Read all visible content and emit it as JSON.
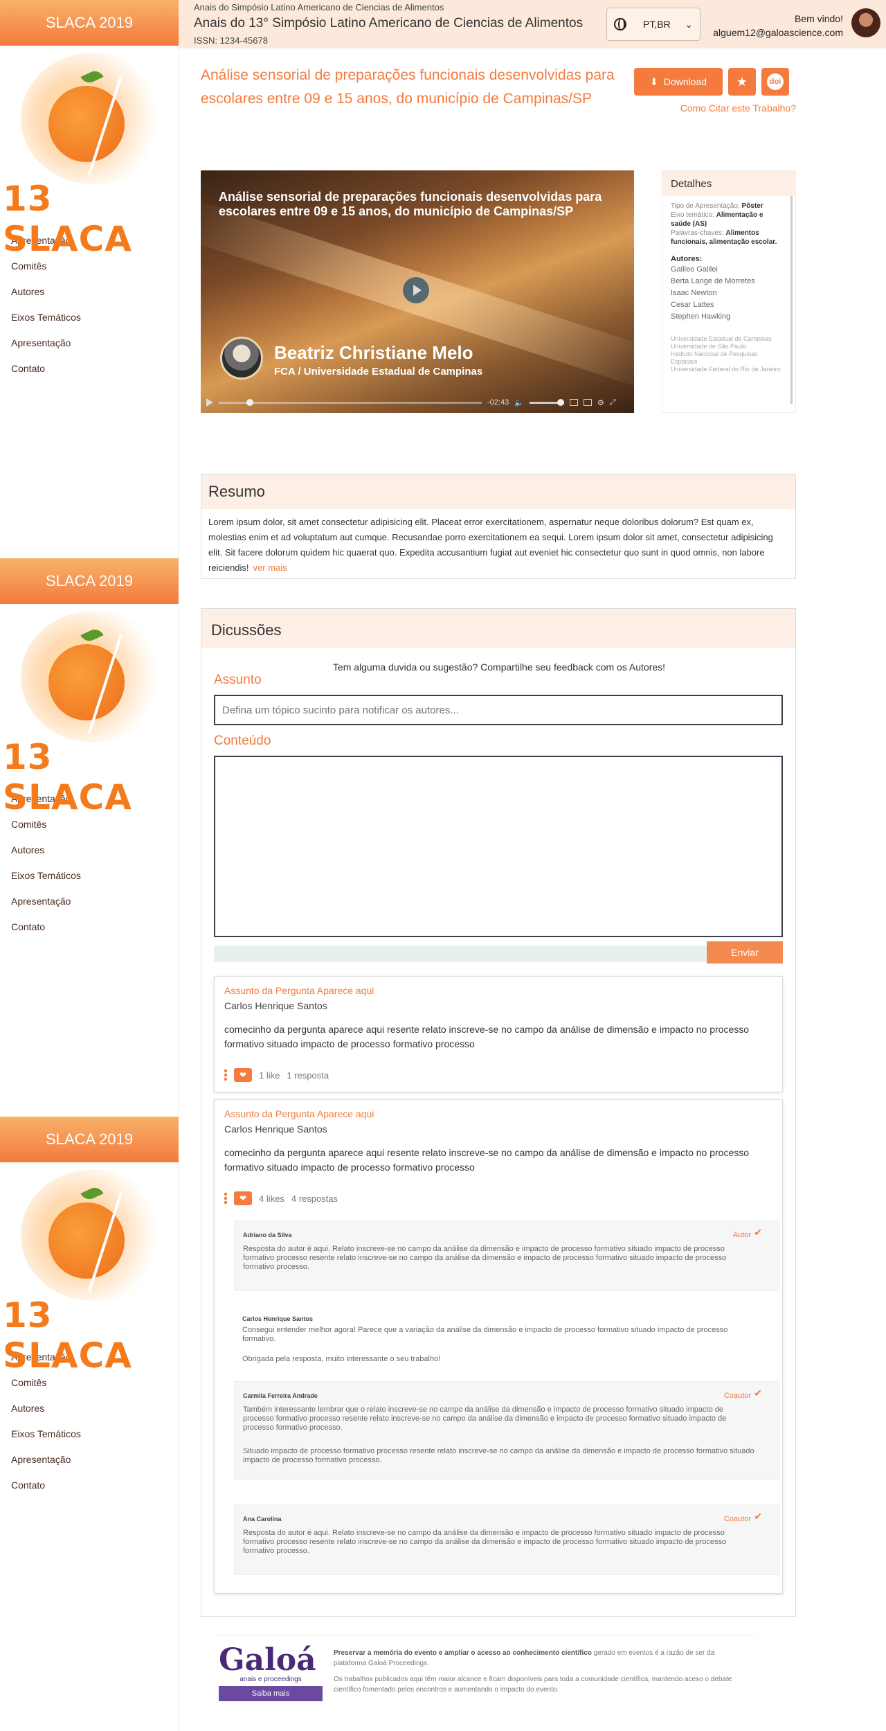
{
  "sidebar": {
    "header": "SLACA 2019",
    "logo_text": "13 SLACA",
    "nav": [
      "Apresentação",
      "Comitês",
      "Autores",
      "Eixos Temáticos",
      "Apresentação",
      "Contato"
    ]
  },
  "topbar": {
    "event_small": "Anais do Simpósio Latino Americano de Ciencias de Alimentos",
    "event_title": "Anais do 13° Simpósio Latino Americano de Ciencias de Alimentos",
    "issn": "ISSN: 1234-45678",
    "language": "PT,BR",
    "welcome": "Bem vindo!",
    "email": "alguem12@galoascience.com"
  },
  "paper": {
    "title": "Análise sensorial de preparações funcionais desenvolvidas para escolares entre 09 e 15 anos, do município de Campinas/SP",
    "download_label": "Download",
    "cite_link": "Como Citar este Trabalho?"
  },
  "video": {
    "title": "Análise sensorial de preparações funcionais desenvolvidas para escolares entre 09 e 15 anos, do município de Campinas/SP",
    "presenter": "Beatriz Christiane Melo",
    "affiliation": "FCA / Universidade Estadual de Campinas",
    "time_remaining": "-02:43"
  },
  "details": {
    "heading": "Detalhes",
    "type_label": "Tipo de Apresentação:",
    "type_value": "Pôster",
    "axis_label": "Eixo temático:",
    "axis_value": "Alimentação e saúde (AS)",
    "keywords_label": "Palavras-chaves:",
    "keywords_value": "Alimentos funcionais, alimentação escolar.",
    "authors_heading": "Autores:",
    "authors": [
      "Galileo Galilei",
      "Berta Lange de Morretes",
      "Isaac Newton",
      "Cesar Lattes",
      "Stephen Hawking"
    ],
    "institutions": [
      "Universidade Estadual de Campinas",
      "Universidade de São Paulo",
      "Instituto Nacional de Pesquisas Espaciais",
      "Universidade Federal do Rio de Janeiro"
    ]
  },
  "resumo": {
    "heading": "Resumo",
    "text": "Lorem ipsum dolor, sit amet consectetur adipisicing elit. Placeat error exercitationem, aspernatur neque doloribus dolorum? Est quam ex, molestias enim et ad voluptatum aut cumque. Recusandae porro exercitationem ea sequi. Lorem ipsum dolor sit amet, consectetur adipisicing elit. Sit facere dolorum quidem hic quaerat quo. Expedita accusantium fugiat aut eveniet hic consectetur quo sunt in quod omnis, non labore reiciendis!",
    "more": "ver mais"
  },
  "discussion": {
    "heading": "Dicussões",
    "prompt": "Tem alguma duvida ou sugestão? Compartilhe seu feedback com os Autores!",
    "subject_label": "Assunto",
    "subject_placeholder": "Defina um tópico sucinto para notificar os autores...",
    "content_label": "Conteúdo",
    "send_label": "Enviar",
    "questions": [
      {
        "subject": "Assunto da Pergunta Aparece aqui",
        "author": "Carlos Henrique Santos",
        "text": "comecinho da pergunta aparece aqui resente relato inscreve-se no campo da análise de dimensão e impacto no processo formativo situado impacto de processo formativo processo",
        "likes": "1 like",
        "replies": "1 resposta"
      },
      {
        "subject": "Assunto da Pergunta Aparece aqui",
        "author": "Carlos Henrique Santos",
        "text": "comecinho da pergunta aparece aqui resente relato inscreve-se no campo da análise de dimensão e impacto no processo formativo situado impacto de processo formativo processo",
        "likes": "4 likes",
        "replies": "4 respostas"
      }
    ],
    "replies": [
      {
        "author": "Adriano da Silva",
        "role": "Autor",
        "text": "Resposta do autor é aqui. Relato inscreve-se no campo da análise da dimensão e impacto de processo formativo situado impacto de processo formativo processo resente relato inscreve-se no campo da análise da dimensão e impacto de processo formativo situado impacto de processo formativo processo."
      },
      {
        "author": "Carlos Henrique Santos",
        "role": "",
        "text": "Consegui entender melhor agora! Parece que a variação da análise da dimensão e impacto de processo formativo situado impacto de processo formativo.",
        "text2": "Obrigada pela resposta, muito interessante o seu trabalho!"
      },
      {
        "author": "Carmila Ferreira Andrade",
        "role": "Coautor",
        "text": "Também interessante lembrar que o relato inscreve-se no campo da análise da dimensão e impacto de processo formativo situado impacto de processo formativo processo resente relato inscreve-se no campo da análise da dimensão e impacto de processo formativo situado impacto de processo formativo processo.",
        "text2": "Situado impacto de processo formativo processo resente relato inscreve-se no campo da análise da dimensão e impacto de processo formativo situado impacto de processo formativo processo."
      },
      {
        "author": "Ana Carolina",
        "role": "Coautor",
        "text": "Resposta do autor é aqui. Relato inscreve-se no campo da análise da dimensão e impacto de processo formativo situado impacto de processo formativo processo resente relato inscreve-se no campo da análise da dimensão e impacto de processo formativo situado impacto de processo formativo processo."
      }
    ]
  },
  "footer": {
    "logo": "Galoá",
    "logo_sub": "anais e proceedings",
    "learn_more": "Saiba mais",
    "text_bold": "Preservar a memória do evento e ampliar o acesso ao conhecimento científico",
    "text_rest": " gerado em eventos é a razão de ser da plataforma Galoá Proceedings.",
    "text2": "Os trabalhos publicados aqui têm maior alcance e ficam disponíveis para toda a comunidade científica, mantendo aceso o debate científico fomentado pelos encontros e aumentando o impacto do evento."
  },
  "colors": {
    "accent": "#f47a3d",
    "header_bg": "#fce9dc",
    "brand_purple": "#4a2a78"
  }
}
